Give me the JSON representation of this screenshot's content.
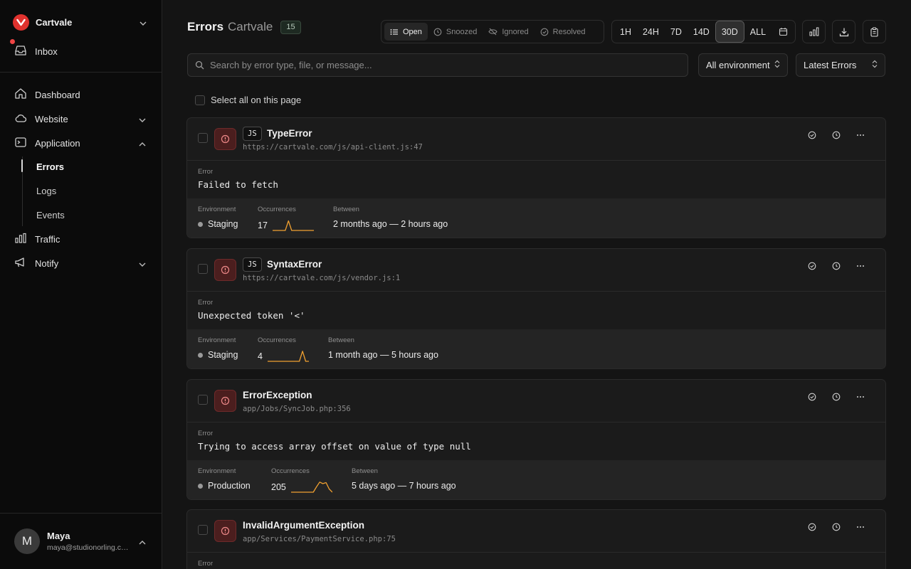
{
  "sidebar": {
    "org_name": "Cartvale",
    "inbox_label": "Inbox",
    "items": [
      {
        "label": "Dashboard"
      },
      {
        "label": "Website"
      },
      {
        "label": "Application"
      },
      {
        "label": "Traffic"
      },
      {
        "label": "Notify"
      }
    ],
    "sub_items": [
      {
        "label": "Errors"
      },
      {
        "label": "Logs"
      },
      {
        "label": "Events"
      }
    ],
    "user": {
      "initial": "M",
      "name": "Maya",
      "email": "maya@studionorling.com"
    }
  },
  "header": {
    "title": "Errors",
    "subtitle": "Cartvale",
    "count": "15",
    "status_tabs": [
      {
        "label": "Open",
        "active": true
      },
      {
        "label": "Snoozed"
      },
      {
        "label": "Ignored"
      },
      {
        "label": "Resolved"
      }
    ],
    "ranges": [
      {
        "label": "1H"
      },
      {
        "label": "24H"
      },
      {
        "label": "7D"
      },
      {
        "label": "14D"
      },
      {
        "label": "30D",
        "active": true
      },
      {
        "label": "ALL"
      }
    ]
  },
  "filters": {
    "search_placeholder": "Search by error type, file, or message...",
    "environment": "All environment",
    "sort": "Latest Errors",
    "select_all": "Select all on this page"
  },
  "labels": {
    "error": "Error",
    "environment": "Environment",
    "occurrences": "Occurrences",
    "between": "Between"
  },
  "errors": [
    {
      "lang": "JS",
      "type": "TypeError",
      "file": "https://cartvale.com/js/api-client.js:47",
      "message": "Failed to fetch",
      "environment": "Staging",
      "occurrences": "17",
      "between": "2 months ago — 2 hours ago",
      "trend": [
        0,
        0,
        0,
        0,
        0,
        0.9,
        0,
        0,
        0,
        0,
        0,
        0,
        0,
        0
      ]
    },
    {
      "lang": "JS",
      "type": "SyntaxError",
      "file": "https://cartvale.com/js/vendor.js:1",
      "message": "Unexpected token '<'",
      "environment": "Staging",
      "occurrences": "4",
      "between": "1 month ago — 5 hours ago",
      "trend": [
        0,
        0,
        0,
        0,
        0,
        0,
        0,
        0,
        0,
        0,
        0,
        0.95,
        0,
        0
      ]
    },
    {
      "lang": "",
      "type": "ErrorException",
      "file": "app/Jobs/SyncJob.php:356",
      "message": "Trying to access array offset on value of type null",
      "environment": "Production",
      "occurrences": "205",
      "between": "5 days ago — 7 hours ago",
      "trend": [
        0,
        0,
        0,
        0,
        0,
        0,
        0,
        0,
        0.5,
        0.95,
        0.8,
        0.9,
        0.3,
        0
      ]
    },
    {
      "lang": "",
      "type": "InvalidArgumentException",
      "file": "app/Services/PaymentService.php:75",
      "message": "",
      "environment": "",
      "occurrences": "",
      "between": "",
      "trend": []
    }
  ],
  "colors": {
    "accent": "#e0322e",
    "spark": "#f0a030",
    "error_icon_bg": "#4b1e1e"
  }
}
